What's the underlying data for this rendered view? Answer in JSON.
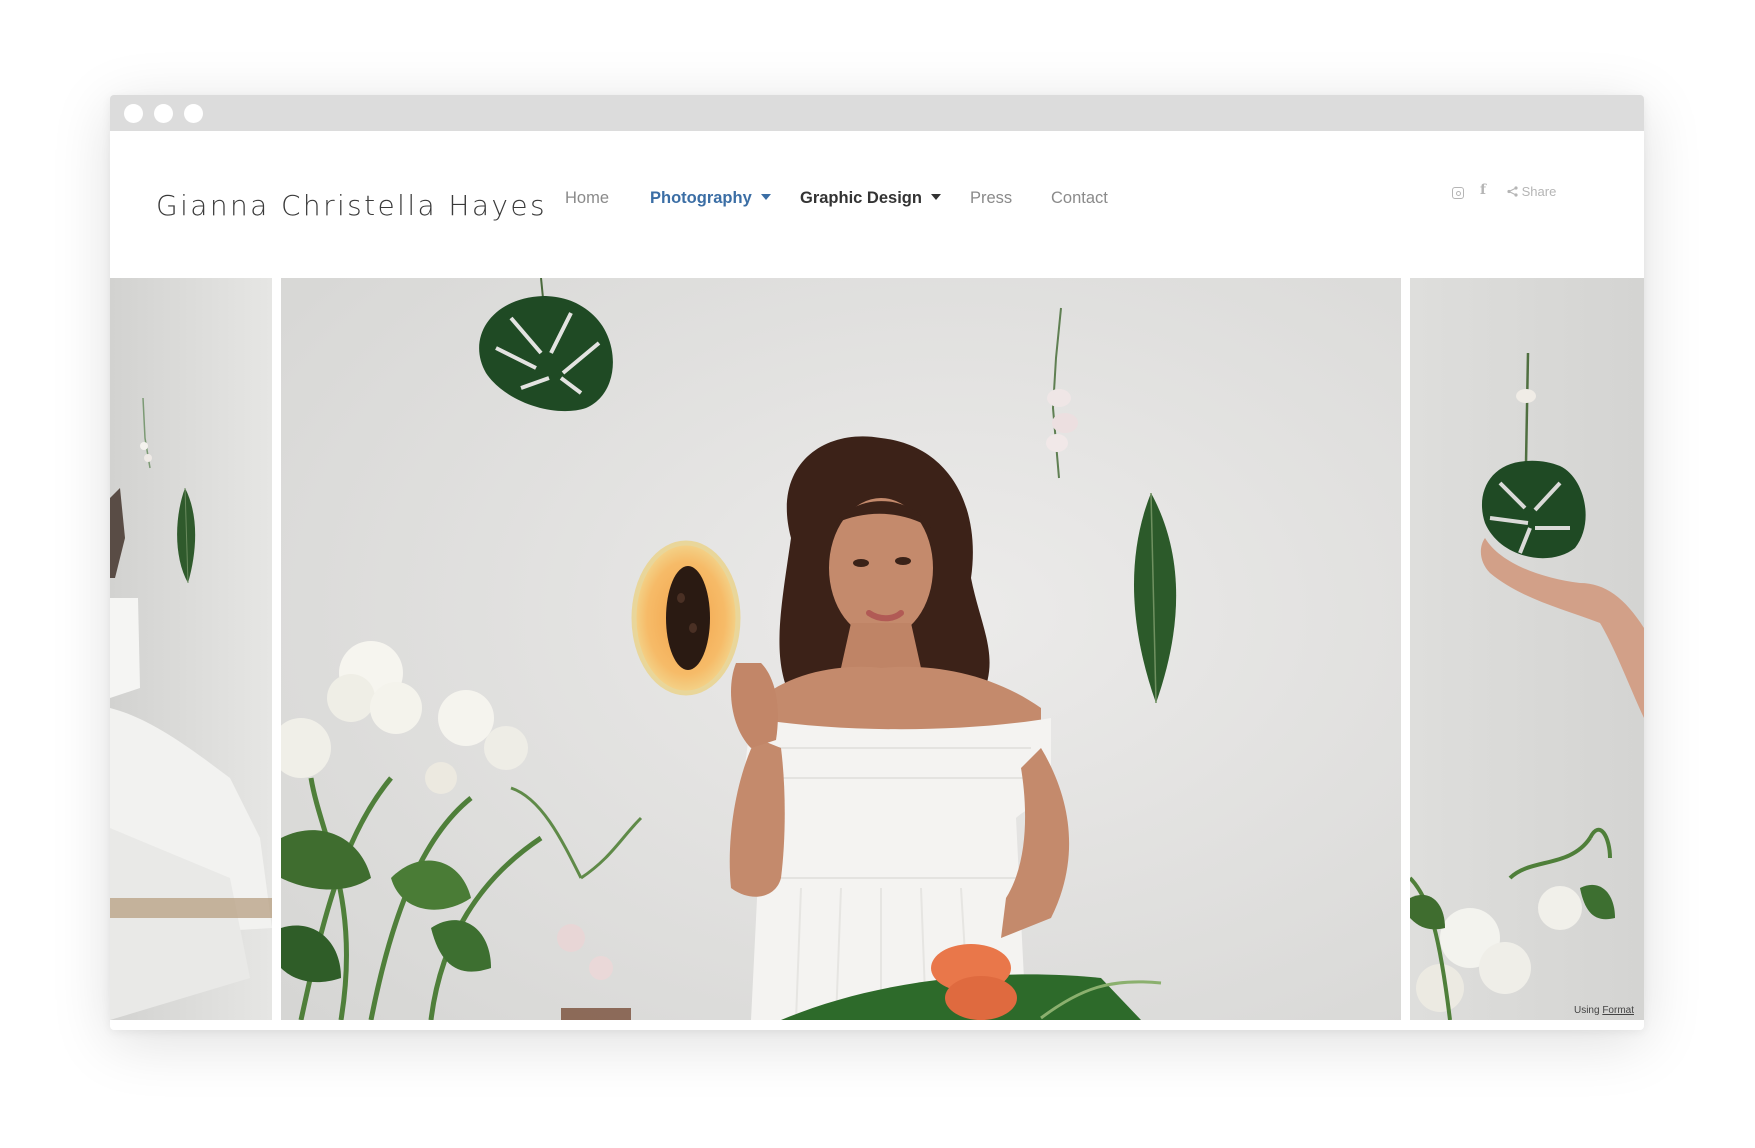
{
  "window": {
    "controls": [
      "close-dot",
      "minimize-dot",
      "maximize-dot"
    ]
  },
  "site": {
    "title": "Gianna Christella Hayes"
  },
  "nav": {
    "home": "Home",
    "photography": "Photography",
    "graphic_design": "Graphic Design",
    "press": "Press",
    "contact": "Contact"
  },
  "social": {
    "instagram_icon": "instagram-icon",
    "facebook_icon": "facebook-icon",
    "share_label": "Share"
  },
  "gallery": {
    "credit_prefix": "Using",
    "credit_link": "Format"
  },
  "colors": {
    "accent": "#3b6ea5",
    "nav_text": "#8a8a8a",
    "title_text": "#3a3a3a",
    "titlebar": "#dcdcdc"
  }
}
